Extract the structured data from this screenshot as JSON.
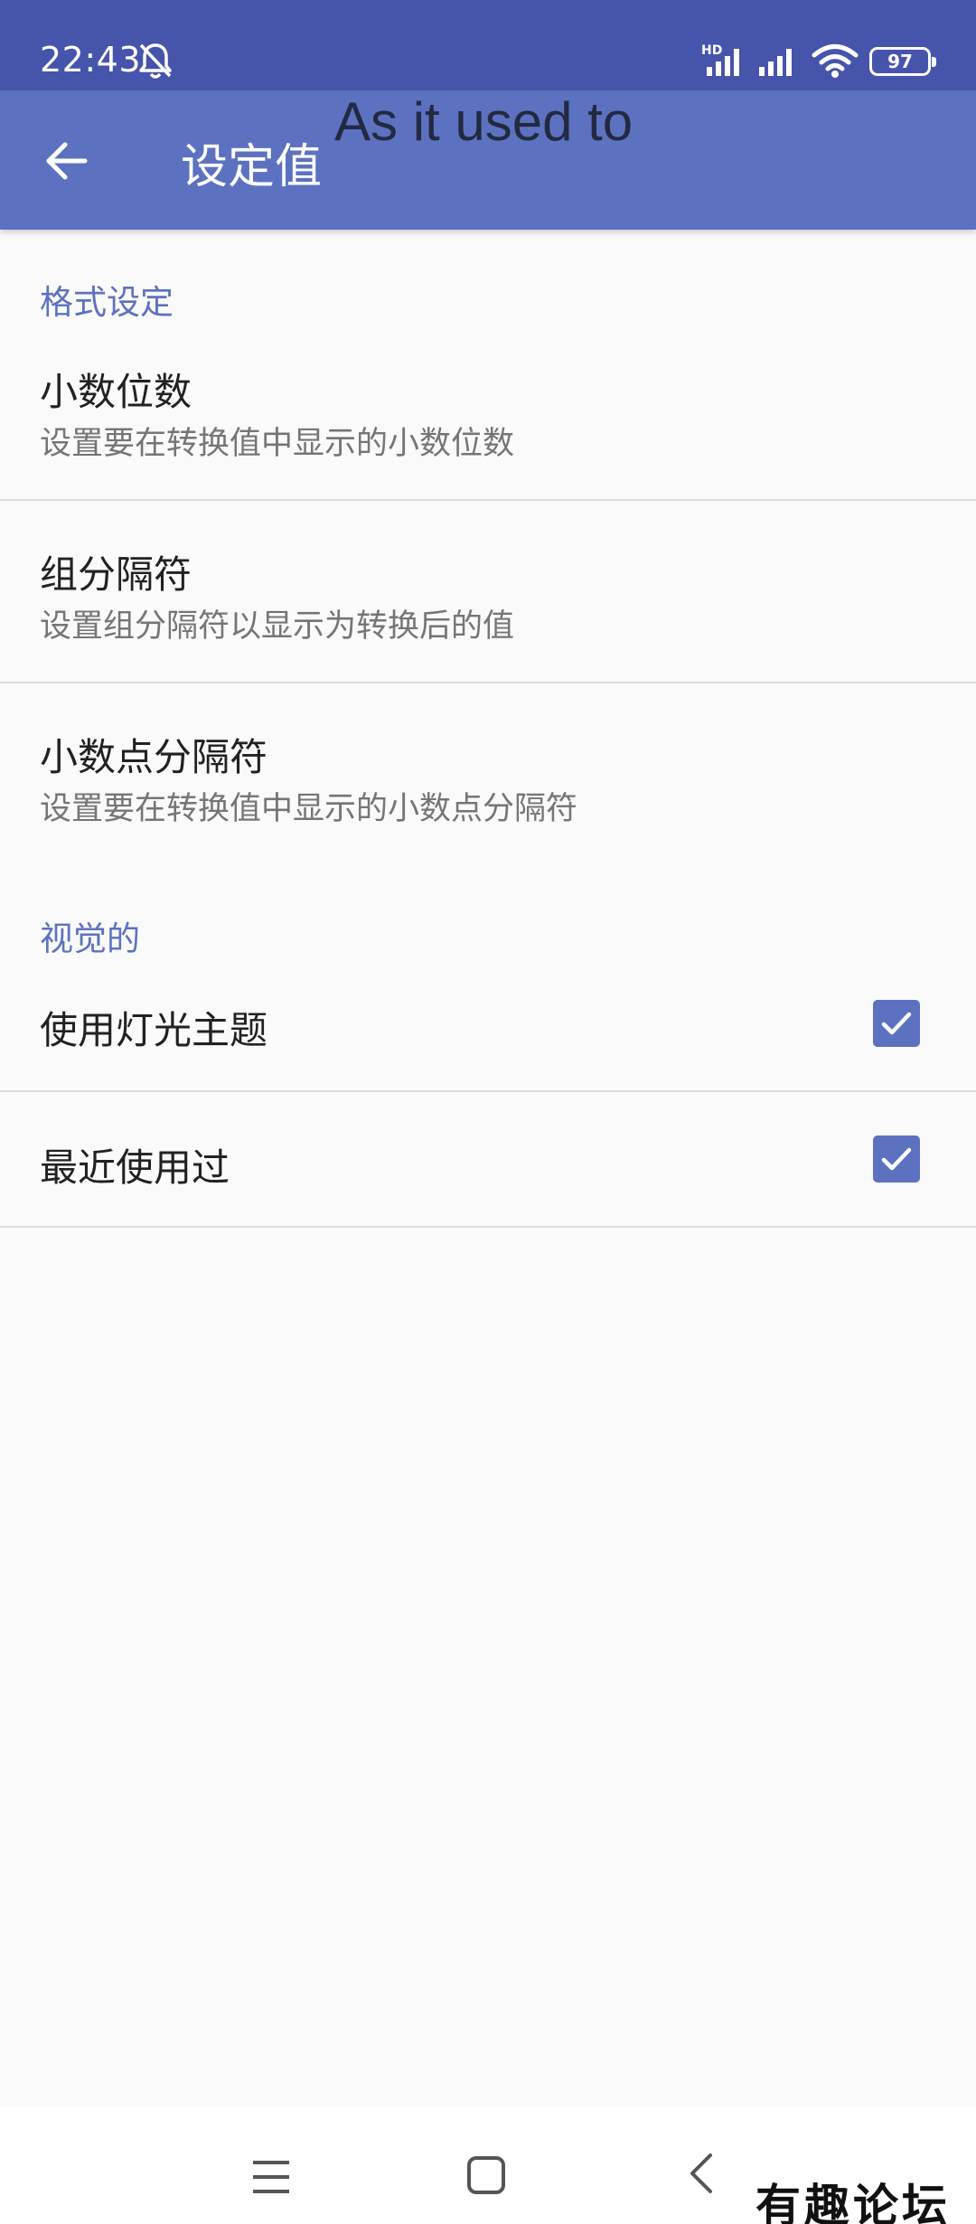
{
  "status_bar": {
    "time": "22:43",
    "network_label": "HD",
    "battery_level": "97",
    "icons": [
      "bell-off-icon",
      "signal-icon",
      "signal-icon",
      "wifi-icon",
      "battery-icon"
    ]
  },
  "app_bar": {
    "title": "设定值",
    "overlay_text": "As it used to",
    "back_icon": "arrow-left-icon"
  },
  "sections": [
    {
      "header": "格式设定",
      "items": [
        {
          "title": "小数位数",
          "summary": "设置要在转换值中显示的小数位数"
        },
        {
          "title": "组分隔符",
          "summary": "设置组分隔符以显示为转换后的值"
        },
        {
          "title": "小数点分隔符",
          "summary": "设置要在转换值中显示的小数点分隔符"
        }
      ]
    },
    {
      "header": "视觉的",
      "items": [
        {
          "title": "使用灯光主题",
          "checked": true
        },
        {
          "title": "最近使用过",
          "checked": true
        }
      ]
    }
  ],
  "nav_bar": {
    "icons": [
      "menu-icon",
      "home-icon",
      "back-icon"
    ]
  },
  "watermark": "有趣论坛",
  "colors": {
    "status_bar": "#4654ab",
    "app_bar": "#5c72c0",
    "accent": "#5c72c0",
    "background": "#fafafa"
  }
}
